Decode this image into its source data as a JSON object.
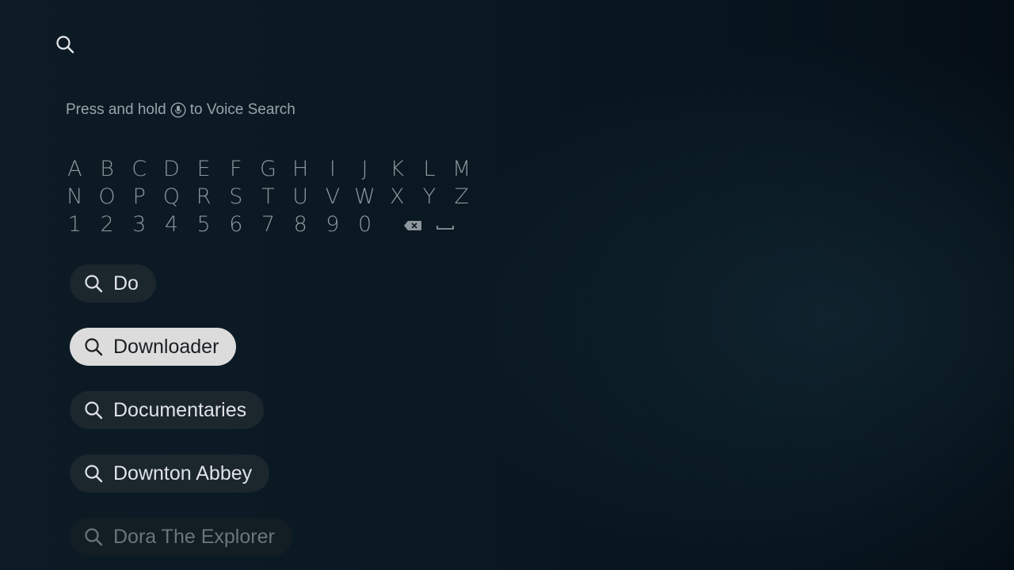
{
  "header": {
    "search_icon": "search-icon"
  },
  "voice_hint": {
    "before": "Press and hold",
    "icon": "microphone-icon",
    "after": "to Voice Search"
  },
  "keyboard": {
    "rows": [
      [
        "A",
        "B",
        "C",
        "D",
        "E",
        "F",
        "G",
        "H",
        "I",
        "J",
        "K",
        "L",
        "M"
      ],
      [
        "N",
        "O",
        "P",
        "Q",
        "R",
        "S",
        "T",
        "U",
        "V",
        "W",
        "X",
        "Y",
        "Z"
      ],
      [
        "1",
        "2",
        "3",
        "4",
        "5",
        "6",
        "7",
        "8",
        "9",
        "0"
      ]
    ],
    "special_keys": [
      {
        "name": "backspace",
        "icon": "backspace-icon"
      },
      {
        "name": "space",
        "icon": "space-icon"
      }
    ]
  },
  "suggestions": [
    {
      "label": "Do",
      "state": "normal"
    },
    {
      "label": "Downloader",
      "state": "selected"
    },
    {
      "label": "Documentaries",
      "state": "normal"
    },
    {
      "label": "Downton Abbey",
      "state": "normal"
    },
    {
      "label": "Dora The Explorer",
      "state": "faded"
    }
  ],
  "colors": {
    "background": "#0a1822",
    "pill_normal": "#1b262d",
    "pill_selected": "#dcdcdc",
    "text": "#dfe3e6",
    "key_text": "#8d969c"
  }
}
